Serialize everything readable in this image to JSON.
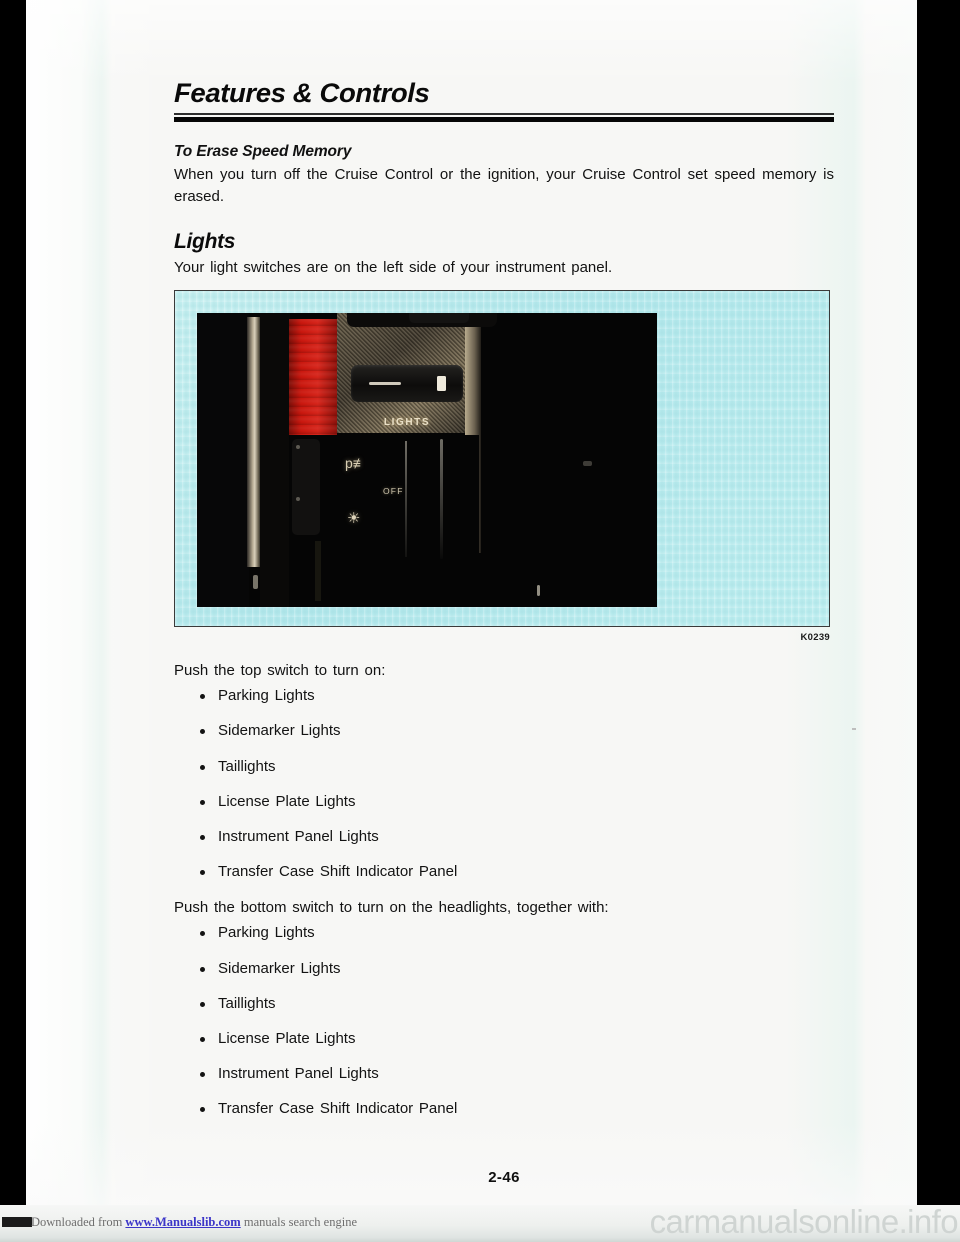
{
  "page": {
    "chapter_title": "Features & Controls",
    "page_number": "2-46"
  },
  "sections": {
    "erase_speed_memory": {
      "heading": "To Erase Speed Memory",
      "body": "When you turn off the Cruise Control or the ignition, your Cruise Control set speed memory is erased."
    },
    "lights": {
      "heading": "Lights",
      "intro": "Your light switches are on the left side of your instrument panel.",
      "figure": {
        "caption": "K0239",
        "background_color": "#b9ebee",
        "photo_labels": {
          "lights": "LIGHTS",
          "off": "OFF",
          "parking_symbol": "parking-lights-symbol",
          "headlight_symbol": "headlight-symbol"
        }
      },
      "top_switch": {
        "lead_in": "Push the top switch to turn on:",
        "items": [
          "Parking Lights",
          "Sidemarker Lights",
          "Taillights",
          "License Plate Lights",
          "Instrument Panel Lights",
          "Transfer Case Shift Indicator Panel"
        ]
      },
      "bottom_switch": {
        "lead_in": "Push the bottom switch to turn on the headlights, together with:",
        "items": [
          "Parking Lights",
          "Sidemarker Lights",
          "Taillights",
          "License Plate Lights",
          "Instrument Panel Lights",
          "Transfer Case Shift Indicator Panel"
        ]
      }
    }
  },
  "footer": {
    "downloaded_prefix": "Downloaded from ",
    "link_text": "www.Manualslib.com",
    "downloaded_suffix": " manuals search engine",
    "watermark": "carmanualsonline.info"
  }
}
